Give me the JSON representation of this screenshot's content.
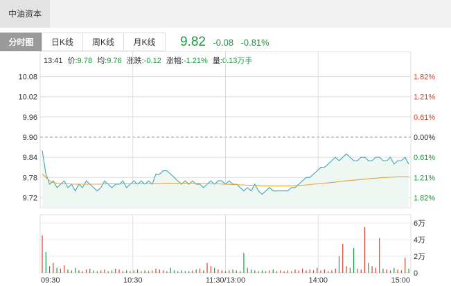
{
  "header": {
    "stock_name": "中油资本"
  },
  "tabs": [
    {
      "label": "分时图",
      "active": true
    },
    {
      "label": "日K线",
      "active": false
    },
    {
      "label": "周K线",
      "active": false
    },
    {
      "label": "月K线",
      "active": false
    }
  ],
  "quote": {
    "price": "9.82",
    "change": "-0.08",
    "change_pct": "-0.81%"
  },
  "info": {
    "time": "13:41",
    "price_label": "价:",
    "price_value": "9.78",
    "avg_label": "均:",
    "avg_value": "9.76",
    "change_label": "涨跌:",
    "change_value": "-0.12",
    "pct_label": "涨幅:",
    "pct_value": "-1.21%",
    "vol_label": "量:",
    "vol_value": "0.13万手"
  },
  "colors": {
    "up": "#d9412a",
    "down": "#1a9a3c",
    "price_line": "#3aa6b9",
    "avg_line": "#e8a03a",
    "price_fill": "#eef7f1",
    "grid": "#dcdcdc"
  },
  "chart_data": {
    "type": "line",
    "x_ticks": [
      "09:30",
      "10:30",
      "11:30/13:00",
      "14:00",
      "15:00"
    ],
    "price_axis": {
      "ylim": [
        9.69,
        10.11
      ],
      "ticks": [
        "10.08",
        "10.02",
        "9.96",
        "9.90",
        "9.84",
        "9.78",
        "9.72"
      ],
      "prev_close": 9.9
    },
    "pct_axis": {
      "ticks": [
        "1.82%",
        "1.21%",
        "0.61%",
        "0.00%",
        "0.61%",
        "1.21%",
        "1.82%"
      ]
    },
    "series": [
      {
        "name": "价",
        "values": [
          9.86,
          9.79,
          9.76,
          9.77,
          9.75,
          9.76,
          9.77,
          9.75,
          9.76,
          9.74,
          9.76,
          9.75,
          9.77,
          9.76,
          9.75,
          9.74,
          9.75,
          9.77,
          9.76,
          9.75,
          9.76,
          9.76,
          9.77,
          9.75,
          9.76,
          9.77,
          9.76,
          9.77,
          9.76,
          9.77,
          9.76,
          9.79,
          9.79,
          9.8,
          9.8,
          9.79,
          9.78,
          9.77,
          9.76,
          9.77,
          9.76,
          9.77,
          9.76,
          9.76,
          9.75,
          9.76,
          9.77,
          9.76,
          9.77,
          9.77,
          9.76,
          9.77,
          9.76,
          9.76,
          9.75,
          9.74,
          9.75,
          9.74,
          9.76,
          9.74,
          9.73,
          9.74,
          9.75,
          9.74,
          9.74,
          9.74,
          9.74,
          9.74,
          9.75,
          9.75,
          9.76,
          9.77,
          9.78,
          9.78,
          9.79,
          9.8,
          9.81,
          9.81,
          9.82,
          9.83,
          9.84,
          9.83,
          9.84,
          9.85,
          9.84,
          9.83,
          9.83,
          9.84,
          9.84,
          9.83,
          9.83,
          9.84,
          9.84,
          9.83,
          9.83,
          9.84,
          9.82,
          9.83,
          9.83,
          9.84,
          9.82
        ]
      },
      {
        "name": "均",
        "values": [
          9.79,
          9.78,
          9.77,
          9.765,
          9.763,
          9.762,
          9.761,
          9.761,
          9.76,
          9.76,
          9.76,
          9.76,
          9.76,
          9.76,
          9.76,
          9.76,
          9.76,
          9.761,
          9.761,
          9.761,
          9.761,
          9.761,
          9.761,
          9.761,
          9.761,
          9.761,
          9.761,
          9.761,
          9.761,
          9.761,
          9.762,
          9.762,
          9.762,
          9.763,
          9.763,
          9.763,
          9.763,
          9.763,
          9.763,
          9.763,
          9.763,
          9.763,
          9.762,
          9.762,
          9.762,
          9.761,
          9.761,
          9.761,
          9.761,
          9.76,
          9.76,
          9.76,
          9.759,
          9.759,
          9.758,
          9.758,
          9.757,
          9.757,
          9.756,
          9.756,
          9.755,
          9.755,
          9.755,
          9.755,
          9.755,
          9.755,
          9.755,
          9.755,
          9.755,
          9.756,
          9.756,
          9.757,
          9.758,
          9.759,
          9.76,
          9.761,
          9.762,
          9.763,
          9.764,
          9.765,
          9.766,
          9.768,
          9.769,
          9.77,
          9.771,
          9.772,
          9.773,
          9.774,
          9.775,
          9.776,
          9.777,
          9.778,
          9.779,
          9.78,
          9.78,
          9.781,
          9.781,
          9.782,
          9.782,
          9.782,
          9.782
        ]
      }
    ],
    "volume_axis": {
      "ticks": [
        "6万",
        "4万",
        "2万",
        "0"
      ],
      "max": 70000
    },
    "volume": [
      45000,
      25000,
      8000,
      12000,
      6000,
      5000,
      9000,
      4000,
      3000,
      6000,
      3000,
      2000,
      4000,
      5000,
      3000,
      2000,
      3000,
      4000,
      2000,
      3000,
      5000,
      4000,
      2000,
      3000,
      2000,
      3000,
      4000,
      2000,
      3000,
      2000,
      3000,
      5000,
      4000,
      3000,
      2000,
      6000,
      3000,
      2000,
      3000,
      2000,
      2000,
      3000,
      4000,
      5000,
      3000,
      12000,
      8000,
      6000,
      4000,
      3000,
      2000,
      3000,
      4000,
      3000,
      2000,
      24000,
      6000,
      4000,
      3000,
      2000,
      3000,
      2000,
      3000,
      4000,
      2000,
      3000,
      2000,
      3000,
      2000,
      4000,
      3000,
      5000,
      3000,
      4000,
      3000,
      6000,
      3000,
      4000,
      2000,
      3000,
      5000,
      20000,
      35000,
      8000,
      6000,
      30000,
      5000,
      4000,
      55000,
      12000,
      8000,
      6000,
      42000,
      5000,
      4000,
      3000,
      6000,
      4000,
      3000,
      18000,
      5000
    ]
  }
}
